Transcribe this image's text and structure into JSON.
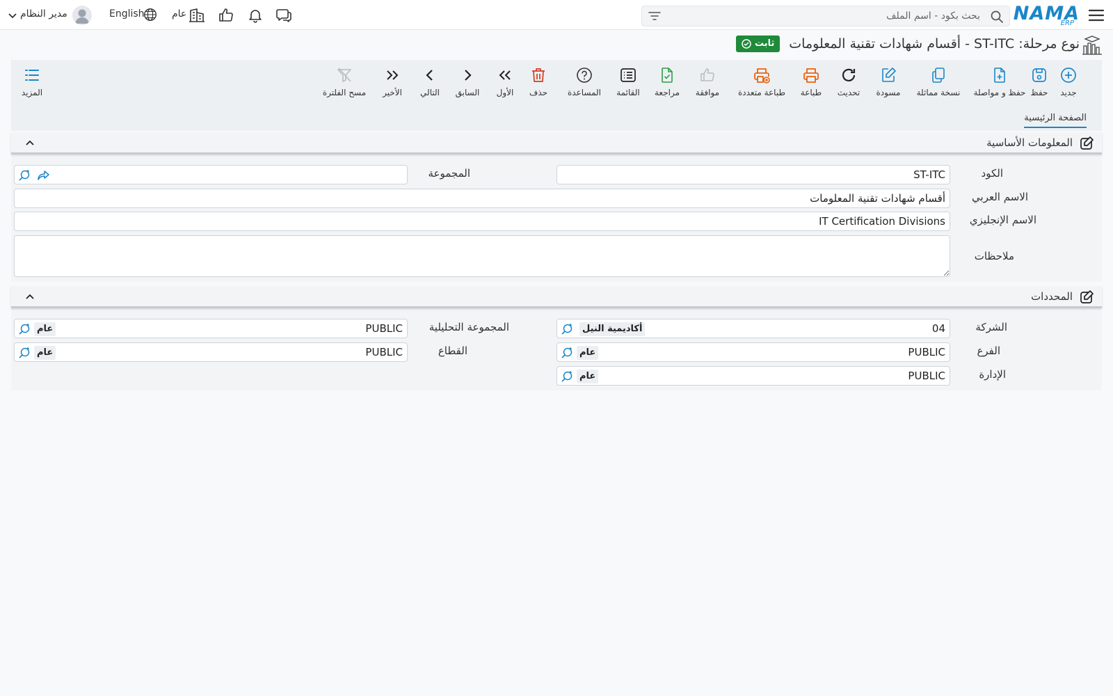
{
  "topbar": {
    "logo_text": "NAMA",
    "logo_sub": "ERP",
    "search_placeholder": "بحث بكود - اسم الملف",
    "branch_label": "عام",
    "language_label": "English",
    "user_name": "مدير النظام"
  },
  "title": {
    "text": "نوع مرحلة: ST-ITC - أقسام شهادات تقنية المعلومات",
    "status": "ثابت"
  },
  "toolbar": {
    "new": "جديد",
    "save": "حفظ",
    "save_continue": "حفظ و مواصلة",
    "duplicate": "نسخة مماثلة",
    "draft": "مسودة",
    "refresh": "تحديث",
    "print": "طباعة",
    "multi_print": "طباعة متعددة",
    "approve": "موافقة",
    "review": "مراجعة",
    "list": "القائمة",
    "help": "المساعدة",
    "delete": "حذف",
    "first": "الأول",
    "previous": "السابق",
    "next": "التالي",
    "last": "الأخير",
    "clear_filter": "مسح الفلترة",
    "more": "المزيد"
  },
  "tabs": {
    "main": "الصفحة الرئيسية"
  },
  "basic_info": {
    "title": "المعلومات الأساسية",
    "code_label": "الكود",
    "code_value": "ST-ITC",
    "group_label": "المجموعة",
    "group_value": "",
    "arabic_name_label": "الاسم العربي",
    "arabic_name_value": "أقسام شهادات تقنية المعلومات",
    "english_name_label": "الاسم الإنجليزي",
    "english_name_value": "IT Certification Divisions",
    "notes_label": "ملاحظات",
    "notes_value": ""
  },
  "dimensions": {
    "title": "المحددات",
    "company_label": "الشركة",
    "company_code": "04",
    "company_name": "أكاديمية النيل",
    "branch_label": "الفرع",
    "branch_code": "PUBLIC",
    "branch_name": "عام",
    "department_label": "الإدارة",
    "department_code": "PUBLIC",
    "department_name": "عام",
    "analysis_group_label": "المجموعة التحليلية",
    "analysis_group_code": "PUBLIC",
    "analysis_group_name": "عام",
    "sector_label": "القطاع",
    "sector_code": "PUBLIC",
    "sector_name": "عام"
  }
}
